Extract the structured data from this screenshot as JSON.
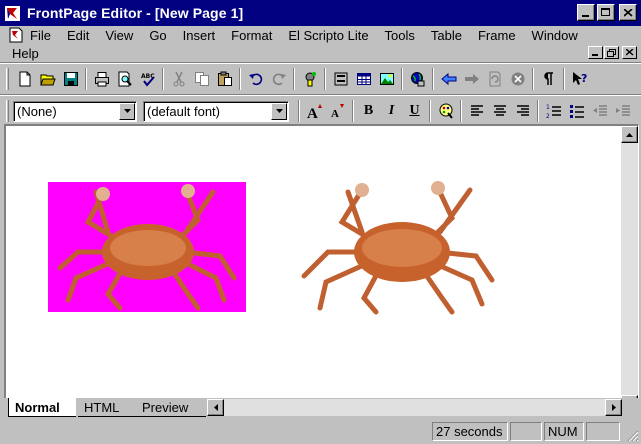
{
  "window": {
    "title": "FrontPage Editor - [New Page 1]"
  },
  "menu": {
    "row1": [
      "File",
      "Edit",
      "View",
      "Go",
      "Insert",
      "Format",
      "El Scripto Lite",
      "Tools",
      "Table",
      "Frame",
      "Window"
    ],
    "row2": [
      "Help"
    ]
  },
  "toolbar_standard": {
    "buttons": [
      "new-page",
      "open",
      "save",
      "print",
      "print-preview",
      "spelling",
      "cut",
      "copy",
      "paste",
      "undo",
      "redo",
      "insert-webbot",
      "insert-form-field",
      "insert-table",
      "insert-image",
      "create-hyperlink",
      "back",
      "forward",
      "refresh",
      "stop",
      "show-paragraph-marks",
      "help"
    ]
  },
  "toolbar_format": {
    "style_select": "(None)",
    "font_select": "(default font)",
    "bold": "B",
    "italic": "I",
    "underline": "U"
  },
  "editor": {
    "images": [
      {
        "name": "crab-magenta-background",
        "background": "#ff00ff"
      },
      {
        "name": "crab-transparent-background"
      }
    ]
  },
  "view_tabs": [
    "Normal",
    "HTML",
    "Preview"
  ],
  "active_tab": "Normal",
  "status": {
    "download_time": "27 seconds",
    "num_lock": "NUM"
  },
  "colors": {
    "titlebar": "#000080",
    "chrome": "#c0c0c0",
    "crab_bg": "#ff00ff"
  }
}
